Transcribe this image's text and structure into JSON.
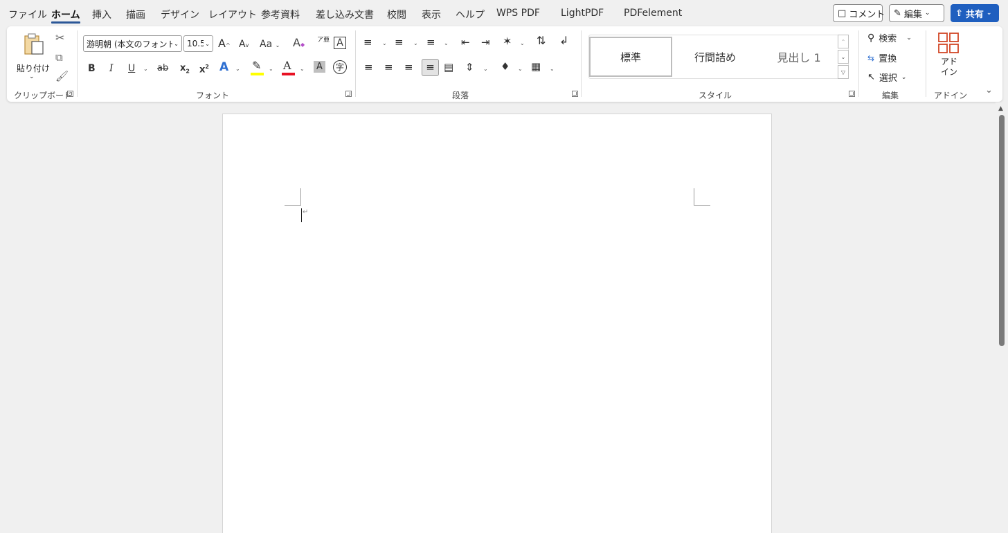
{
  "menu": {
    "tabs": [
      "ファイル",
      "ホーム",
      "挿入",
      "描画",
      "デザイン",
      "レイアウト",
      "参考資料",
      "差し込み文書",
      "校閲",
      "表示",
      "ヘルプ",
      "WPS PDF",
      "LightPDF",
      "PDFelement"
    ],
    "active_tab": "ホーム",
    "comment_label": "コメント",
    "edit_label": "編集",
    "share_label": "共有"
  },
  "clipboard": {
    "paste_label": "貼り付け",
    "group_label": "クリップボード"
  },
  "font": {
    "font_name": "游明朝 (本文のフォント",
    "font_size": "10.5",
    "group_label": "フォント",
    "grow_label": "A",
    "shrink_label": "A",
    "case_label": "Aa",
    "bold": "B",
    "italic": "I",
    "underline": "U",
    "strike": "ab",
    "subscript": "x",
    "superscript": "x",
    "text_effect": "A",
    "font_color": "A",
    "char_shading": "A",
    "char_border": "A",
    "phonetic": "ア亜",
    "enclose": "字",
    "clear_format": "A",
    "highlight_color": "#ffff00",
    "font_color_value": "#e81123"
  },
  "paragraph": {
    "group_label": "段落"
  },
  "styles": {
    "group_label": "スタイル",
    "items": [
      "標準",
      "行間詰め",
      "見出し 1"
    ]
  },
  "editing": {
    "group_label": "編集",
    "find_label": "検索",
    "replace_label": "置換",
    "select_label": "選択"
  },
  "addins": {
    "label": "アド\nイン",
    "group_label": "アドイン"
  },
  "accent_color": "#2b5797"
}
